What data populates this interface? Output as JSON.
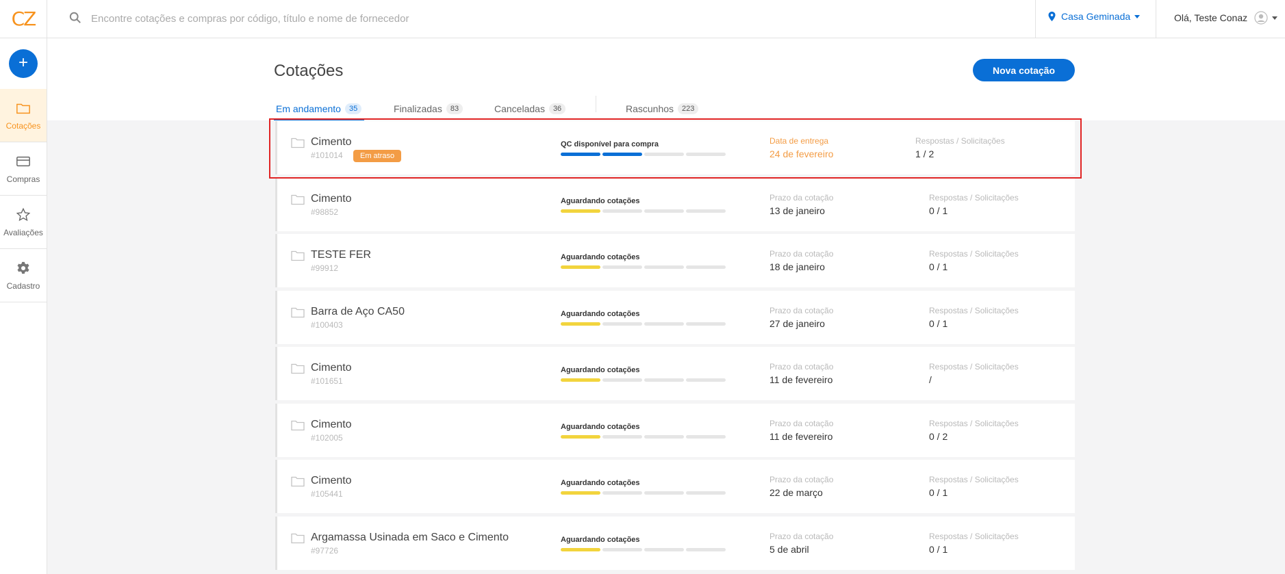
{
  "app": {
    "logo": "CZ"
  },
  "search": {
    "placeholder": "Encontre cotações e compras por código, título e nome de fornecedor"
  },
  "location": {
    "label": "Casa Geminada"
  },
  "user": {
    "greeting": "Olá, Teste Conaz"
  },
  "sidebar": {
    "add_label": "+",
    "items": [
      {
        "label": "Cotações",
        "icon": "folder-icon",
        "active": true
      },
      {
        "label": "Compras",
        "icon": "card-icon",
        "active": false
      },
      {
        "label": "Avaliações",
        "icon": "star-icon",
        "active": false
      },
      {
        "label": "Cadastro",
        "icon": "gear-icon",
        "active": false
      }
    ]
  },
  "page": {
    "title": "Cotações",
    "new_button": "Nova cotação"
  },
  "tabs": [
    {
      "label": "Em andamento",
      "count": "35",
      "active": true
    },
    {
      "label": "Finalizadas",
      "count": "83",
      "active": false
    },
    {
      "label": "Canceladas",
      "count": "36",
      "active": false
    },
    {
      "label": "Rascunhos",
      "count": "223",
      "active": false
    }
  ],
  "colors": {
    "accent": "#0a6fd6",
    "brand": "#f7931e",
    "late": "#f39c45",
    "waiting": "#f2d43d"
  },
  "rows": [
    {
      "title": "Cimento",
      "id": "#101014",
      "badge": "Em atraso",
      "status": "QC disponível para compra",
      "progress_steps": 2,
      "progress_color": "blue",
      "date_label": "Data de entrega",
      "date_value": "24 de fevereiro",
      "resp_label": "Respostas / Solicitações",
      "resp_value": "1 / 2"
    },
    {
      "title": "Cimento",
      "id": "#98852",
      "status": "Aguardando cotações",
      "progress_steps": 1,
      "progress_color": "yellow",
      "date_label": "Prazo da cotação",
      "date_value": "13 de janeiro",
      "resp_label": "Respostas / Solicitações",
      "resp_value": "0 / 1"
    },
    {
      "title": "TESTE FER",
      "id": "#99912",
      "status": "Aguardando cotações",
      "progress_steps": 1,
      "progress_color": "yellow",
      "date_label": "Prazo da cotação",
      "date_value": "18 de janeiro",
      "resp_label": "Respostas / Solicitações",
      "resp_value": "0 / 1"
    },
    {
      "title": "Barra de Aço CA50",
      "id": "#100403",
      "status": "Aguardando cotações",
      "progress_steps": 1,
      "progress_color": "yellow",
      "date_label": "Prazo da cotação",
      "date_value": "27 de janeiro",
      "resp_label": "Respostas / Solicitações",
      "resp_value": "0 / 1"
    },
    {
      "title": "Cimento",
      "id": "#101651",
      "status": "Aguardando cotações",
      "progress_steps": 1,
      "progress_color": "yellow",
      "date_label": "Prazo da cotação",
      "date_value": "11 de fevereiro",
      "resp_label": "Respostas / Solicitações",
      "resp_value": "/"
    },
    {
      "title": "Cimento",
      "id": "#102005",
      "status": "Aguardando cotações",
      "progress_steps": 1,
      "progress_color": "yellow",
      "date_label": "Prazo da cotação",
      "date_value": "11 de fevereiro",
      "resp_label": "Respostas / Solicitações",
      "resp_value": "0 / 2"
    },
    {
      "title": "Cimento",
      "id": "#105441",
      "status": "Aguardando cotações",
      "progress_steps": 1,
      "progress_color": "yellow",
      "date_label": "Prazo da cotação",
      "date_value": "22 de março",
      "resp_label": "Respostas / Solicitações",
      "resp_value": "0 / 1"
    },
    {
      "title": "Argamassa Usinada em Saco e Cimento",
      "id": "#97726",
      "status": "Aguardando cotações",
      "progress_steps": 1,
      "progress_color": "yellow",
      "date_label": "Prazo da cotação",
      "date_value": "5 de abril",
      "resp_label": "Respostas / Solicitações",
      "resp_value": "0 / 1"
    }
  ]
}
